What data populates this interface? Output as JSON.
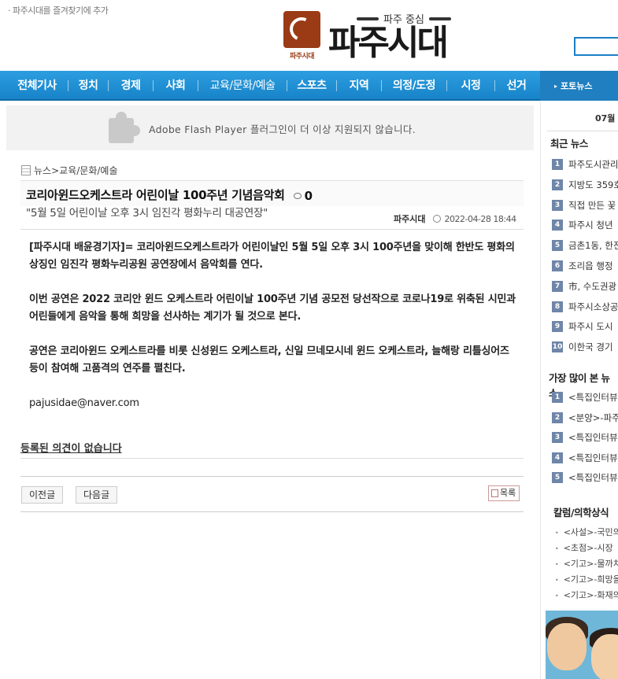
{
  "header": {
    "bookmark": "· 파주시대를 즐겨찾기에 추가",
    "logo_tagline": "파주 중심",
    "logo_name": "파주시대",
    "logo_sub": "파주시대"
  },
  "nav": {
    "items": [
      "전체기사",
      "정치",
      "경제",
      "사회",
      "교육/문화/예술",
      "스포츠",
      "지역",
      "의정/도정",
      "시정",
      "선거"
    ],
    "right": "포토뉴스"
  },
  "flash": {
    "message": "Adobe Flash Player 플러그인이 더 이상 지원되지 않습니다."
  },
  "breadcrumb": {
    "root": "뉴스",
    "sep": " > ",
    "section": "교육/문화/예술"
  },
  "article": {
    "title": "코리아윈드오케스트라 어린이날 100주년 기념음악회",
    "comment_count": "0",
    "subtitle": "\"5월 5일 어린이날 오후 3시 임진각 평화누리 대공연장\"",
    "source": "파주시대",
    "datetime": "2022-04-28 18:44",
    "paragraphs": [
      "[파주시대 배윤경기자]= 코리아윈드오케스트라가 어린이날인 5월 5일 오후 3시 100주년을 맞이해 한반도 평화의 상징인 임진각 평화누리공원 공연장에서 음악회를 연다.",
      "이번 공연은 2022 코리안 윈드 오케스트라 어린이날 100주년 기념 공모전 당선작으로 코로나19로 위축된 시민과 어린들에게 음악을 통해 희망을 선사하는 계기가 될 것으로 본다.",
      "공연은 코리아윈드 오케스트라를 비롯 신성윈드 오케스트라, 신일 므네모시네 윈드 오케스트라, 늘해랑 리틀싱어즈 등이 참여해 고품격의 연주를 펼친다."
    ],
    "email": "pajusidae@naver.com"
  },
  "comments": {
    "empty": "등록된 의견이 없습니다"
  },
  "buttons": {
    "prev": "이전글",
    "next": "다음글",
    "list": "목록"
  },
  "sidebar": {
    "month": "07월",
    "recent_title": "최근 뉴스",
    "recent": [
      {
        "n": "1",
        "text": "파주도시관리"
      },
      {
        "n": "2",
        "text": "지방도 359호"
      },
      {
        "n": "3",
        "text": "직접 만든 꽃"
      },
      {
        "n": "4",
        "text": "파주시 청년"
      },
      {
        "n": "5",
        "text": "금촌1동, 한전"
      },
      {
        "n": "6",
        "text": "조리읍 행정"
      },
      {
        "n": "7",
        "text": "市, 수도권광"
      },
      {
        "n": "8",
        "text": "파주시소상공"
      },
      {
        "n": "9",
        "text": "파주시 도시"
      },
      {
        "n": "10",
        "text": "이한국 경기"
      }
    ],
    "popular_title": "가장 많이 본 뉴스",
    "popular": [
      {
        "n": "1",
        "text": "<특집인터뷰"
      },
      {
        "n": "2",
        "text": "<분양>-파주"
      },
      {
        "n": "3",
        "text": "<특집인터뷰"
      },
      {
        "n": "4",
        "text": "<특집인터뷰"
      },
      {
        "n": "5",
        "text": "<특집인터뷰"
      }
    ],
    "column_title": "칼럼/의학상식",
    "columns": [
      "<사설>-국민의",
      "<초점>-시장",
      "<기고>-물까치",
      "<기고>-희망을",
      "<기고>-화재의"
    ]
  }
}
